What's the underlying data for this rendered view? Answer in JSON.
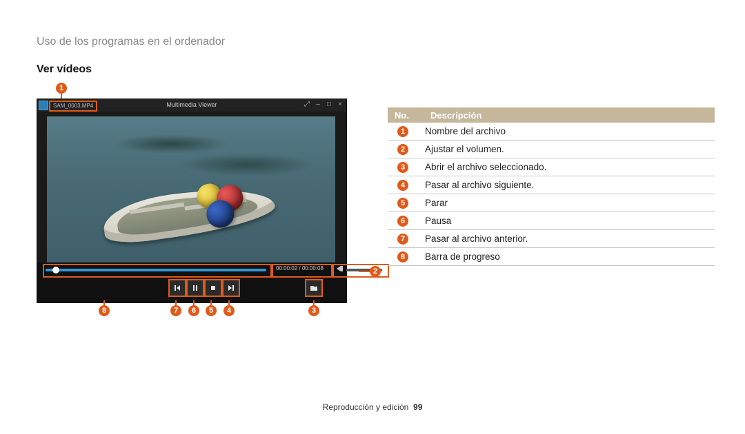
{
  "header": "Uso de los programas en el ordenador",
  "subtitle": "Ver vídeos",
  "player": {
    "app_title": "Multimedia Viewer",
    "filename": "SAM_0003.MP4",
    "time_left": "00:00:02",
    "time_right": "00:00:08"
  },
  "table": {
    "col_no": "No.",
    "col_desc": "Descripción",
    "rows": [
      {
        "n": "1",
        "d": "Nombre del archivo"
      },
      {
        "n": "2",
        "d": "Ajustar el volumen."
      },
      {
        "n": "3",
        "d": "Abrir el archivo seleccionado."
      },
      {
        "n": "4",
        "d": "Pasar al archivo siguiente."
      },
      {
        "n": "5",
        "d": "Parar"
      },
      {
        "n": "6",
        "d": "Pausa"
      },
      {
        "n": "7",
        "d": "Pasar al archivo anterior."
      },
      {
        "n": "8",
        "d": "Barra de progreso"
      }
    ]
  },
  "footer_section": "Reproducción y edición",
  "footer_page": "99"
}
